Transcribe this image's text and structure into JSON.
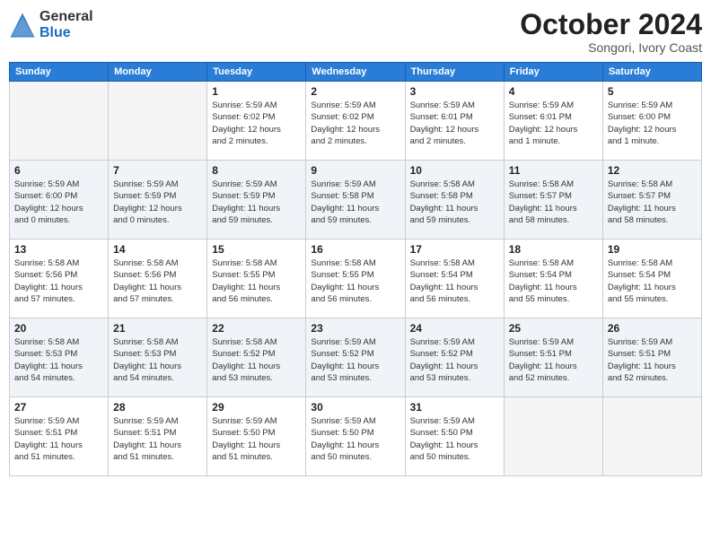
{
  "logo": {
    "general": "General",
    "blue": "Blue"
  },
  "title": "October 2024",
  "subtitle": "Songori, Ivory Coast",
  "weekdays": [
    "Sunday",
    "Monday",
    "Tuesday",
    "Wednesday",
    "Thursday",
    "Friday",
    "Saturday"
  ],
  "weeks": [
    [
      {
        "day": "",
        "info": ""
      },
      {
        "day": "",
        "info": ""
      },
      {
        "day": "1",
        "info": "Sunrise: 5:59 AM\nSunset: 6:02 PM\nDaylight: 12 hours\nand 2 minutes."
      },
      {
        "day": "2",
        "info": "Sunrise: 5:59 AM\nSunset: 6:02 PM\nDaylight: 12 hours\nand 2 minutes."
      },
      {
        "day": "3",
        "info": "Sunrise: 5:59 AM\nSunset: 6:01 PM\nDaylight: 12 hours\nand 2 minutes."
      },
      {
        "day": "4",
        "info": "Sunrise: 5:59 AM\nSunset: 6:01 PM\nDaylight: 12 hours\nand 1 minute."
      },
      {
        "day": "5",
        "info": "Sunrise: 5:59 AM\nSunset: 6:00 PM\nDaylight: 12 hours\nand 1 minute."
      }
    ],
    [
      {
        "day": "6",
        "info": "Sunrise: 5:59 AM\nSunset: 6:00 PM\nDaylight: 12 hours\nand 0 minutes."
      },
      {
        "day": "7",
        "info": "Sunrise: 5:59 AM\nSunset: 5:59 PM\nDaylight: 12 hours\nand 0 minutes."
      },
      {
        "day": "8",
        "info": "Sunrise: 5:59 AM\nSunset: 5:59 PM\nDaylight: 11 hours\nand 59 minutes."
      },
      {
        "day": "9",
        "info": "Sunrise: 5:59 AM\nSunset: 5:58 PM\nDaylight: 11 hours\nand 59 minutes."
      },
      {
        "day": "10",
        "info": "Sunrise: 5:58 AM\nSunset: 5:58 PM\nDaylight: 11 hours\nand 59 minutes."
      },
      {
        "day": "11",
        "info": "Sunrise: 5:58 AM\nSunset: 5:57 PM\nDaylight: 11 hours\nand 58 minutes."
      },
      {
        "day": "12",
        "info": "Sunrise: 5:58 AM\nSunset: 5:57 PM\nDaylight: 11 hours\nand 58 minutes."
      }
    ],
    [
      {
        "day": "13",
        "info": "Sunrise: 5:58 AM\nSunset: 5:56 PM\nDaylight: 11 hours\nand 57 minutes."
      },
      {
        "day": "14",
        "info": "Sunrise: 5:58 AM\nSunset: 5:56 PM\nDaylight: 11 hours\nand 57 minutes."
      },
      {
        "day": "15",
        "info": "Sunrise: 5:58 AM\nSunset: 5:55 PM\nDaylight: 11 hours\nand 56 minutes."
      },
      {
        "day": "16",
        "info": "Sunrise: 5:58 AM\nSunset: 5:55 PM\nDaylight: 11 hours\nand 56 minutes."
      },
      {
        "day": "17",
        "info": "Sunrise: 5:58 AM\nSunset: 5:54 PM\nDaylight: 11 hours\nand 56 minutes."
      },
      {
        "day": "18",
        "info": "Sunrise: 5:58 AM\nSunset: 5:54 PM\nDaylight: 11 hours\nand 55 minutes."
      },
      {
        "day": "19",
        "info": "Sunrise: 5:58 AM\nSunset: 5:54 PM\nDaylight: 11 hours\nand 55 minutes."
      }
    ],
    [
      {
        "day": "20",
        "info": "Sunrise: 5:58 AM\nSunset: 5:53 PM\nDaylight: 11 hours\nand 54 minutes."
      },
      {
        "day": "21",
        "info": "Sunrise: 5:58 AM\nSunset: 5:53 PM\nDaylight: 11 hours\nand 54 minutes."
      },
      {
        "day": "22",
        "info": "Sunrise: 5:58 AM\nSunset: 5:52 PM\nDaylight: 11 hours\nand 53 minutes."
      },
      {
        "day": "23",
        "info": "Sunrise: 5:59 AM\nSunset: 5:52 PM\nDaylight: 11 hours\nand 53 minutes."
      },
      {
        "day": "24",
        "info": "Sunrise: 5:59 AM\nSunset: 5:52 PM\nDaylight: 11 hours\nand 53 minutes."
      },
      {
        "day": "25",
        "info": "Sunrise: 5:59 AM\nSunset: 5:51 PM\nDaylight: 11 hours\nand 52 minutes."
      },
      {
        "day": "26",
        "info": "Sunrise: 5:59 AM\nSunset: 5:51 PM\nDaylight: 11 hours\nand 52 minutes."
      }
    ],
    [
      {
        "day": "27",
        "info": "Sunrise: 5:59 AM\nSunset: 5:51 PM\nDaylight: 11 hours\nand 51 minutes."
      },
      {
        "day": "28",
        "info": "Sunrise: 5:59 AM\nSunset: 5:51 PM\nDaylight: 11 hours\nand 51 minutes."
      },
      {
        "day": "29",
        "info": "Sunrise: 5:59 AM\nSunset: 5:50 PM\nDaylight: 11 hours\nand 51 minutes."
      },
      {
        "day": "30",
        "info": "Sunrise: 5:59 AM\nSunset: 5:50 PM\nDaylight: 11 hours\nand 50 minutes."
      },
      {
        "day": "31",
        "info": "Sunrise: 5:59 AM\nSunset: 5:50 PM\nDaylight: 11 hours\nand 50 minutes."
      },
      {
        "day": "",
        "info": ""
      },
      {
        "day": "",
        "info": ""
      }
    ]
  ]
}
